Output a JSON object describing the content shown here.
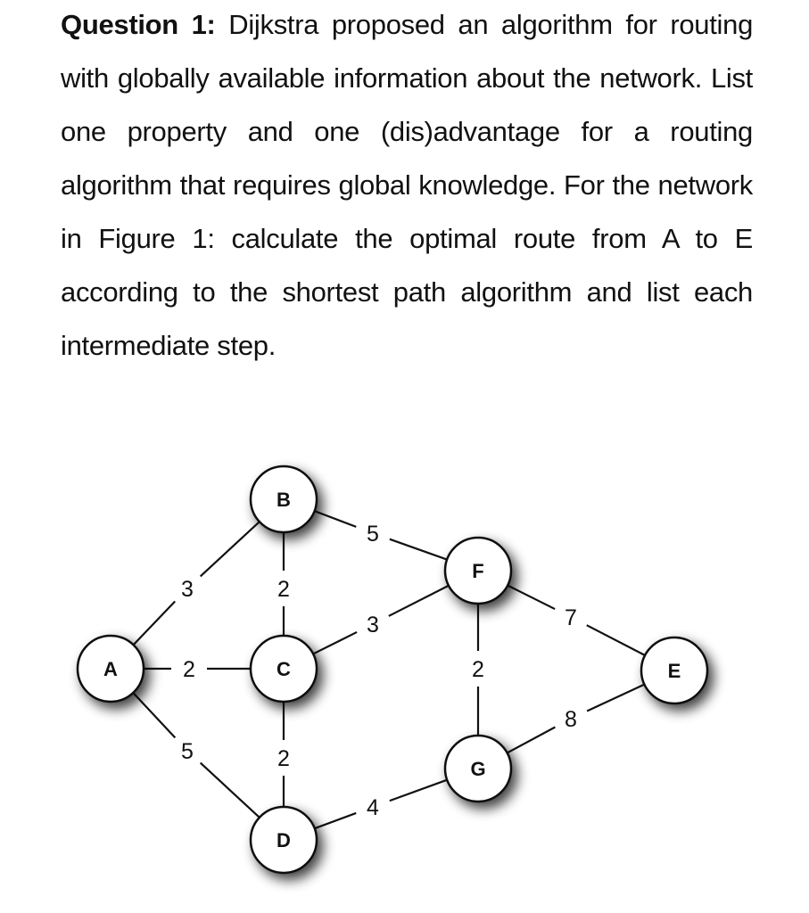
{
  "question": {
    "heading": "Question 1:",
    "body": " Dijkstra proposed an algorithm for routing with globally available information about the network. List one property and one (dis)advantage for a routing algorithm that requires global knowledge. For the network in Figure 1: calculate the optimal route from A to E according to the shortest path algorithm and list each intermediate step."
  },
  "figure": {
    "caption_ref": "Figure 1",
    "nodes": [
      {
        "id": "A"
      },
      {
        "id": "B"
      },
      {
        "id": "C"
      },
      {
        "id": "D"
      },
      {
        "id": "E"
      },
      {
        "id": "F"
      },
      {
        "id": "G"
      }
    ],
    "edges": [
      {
        "from": "A",
        "to": "B",
        "weight": "3"
      },
      {
        "from": "A",
        "to": "C",
        "weight": "2"
      },
      {
        "from": "A",
        "to": "D",
        "weight": "5"
      },
      {
        "from": "B",
        "to": "C",
        "weight": "2"
      },
      {
        "from": "B",
        "to": "F",
        "weight": "5"
      },
      {
        "from": "C",
        "to": "F",
        "weight": "3"
      },
      {
        "from": "C",
        "to": "D",
        "weight": "2"
      },
      {
        "from": "D",
        "to": "G",
        "weight": "4"
      },
      {
        "from": "F",
        "to": "G",
        "weight": "2"
      },
      {
        "from": "F",
        "to": "E",
        "weight": "7"
      },
      {
        "from": "G",
        "to": "E",
        "weight": "8"
      }
    ]
  }
}
